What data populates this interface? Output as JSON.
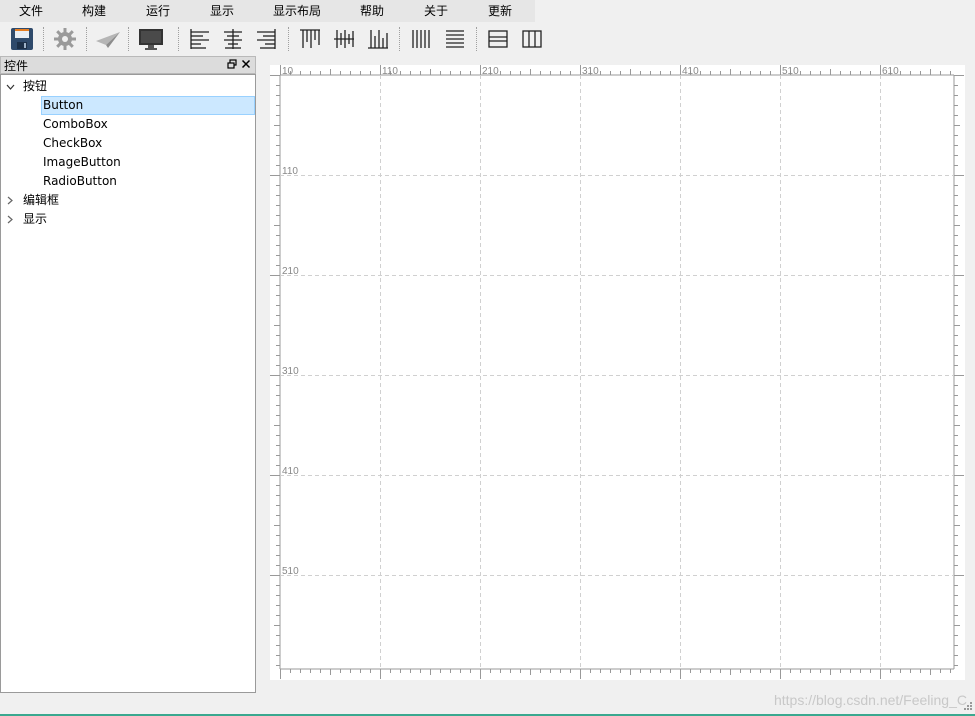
{
  "menu": [
    {
      "label": "文件",
      "w": 62
    },
    {
      "label": "构建",
      "w": 64
    },
    {
      "label": "运行",
      "w": 64
    },
    {
      "label": "显示",
      "w": 64
    },
    {
      "label": "显示布局",
      "w": 86
    },
    {
      "label": "帮助",
      "w": 64
    },
    {
      "label": "关于",
      "w": 64
    },
    {
      "label": "更新",
      "w": 64
    }
  ],
  "toolbar": {
    "buttons": [
      "save-icon",
      "settings-gear-icon",
      "send-paper-plane-icon",
      "monitor-icon",
      "align-left-icon",
      "align-center-horizontal-icon",
      "align-right-icon",
      "align-top-icon",
      "align-middle-vertical-icon",
      "align-bottom-icon",
      "distribute-horizontal-icon",
      "distribute-vertical-icon",
      "split-horizontal-icon",
      "split-vertical-icon"
    ]
  },
  "dock": {
    "title": "控件",
    "tree": [
      {
        "label": "按钮",
        "expanded": true,
        "children": [
          "Button",
          "ComboBox",
          "CheckBox",
          "ImageButton",
          "RadioButton"
        ],
        "selected": "Button"
      },
      {
        "label": "编辑框",
        "expanded": false,
        "children": []
      },
      {
        "label": "显示",
        "expanded": false,
        "children": []
      }
    ]
  },
  "canvas": {
    "ruler_x_labels": [
      "10",
      "110",
      "210",
      "310",
      "410",
      "510",
      "610"
    ],
    "ruler_y_labels": [
      "110",
      "210",
      "310",
      "410",
      "510"
    ]
  },
  "watermark": "https://blog.csdn.net/Feeling_C",
  "colors": {
    "selection_bg": "#cce8ff",
    "selection_border": "#99d1ff",
    "grid_line": "#d0d0d0",
    "ruler_text": "#888888"
  }
}
